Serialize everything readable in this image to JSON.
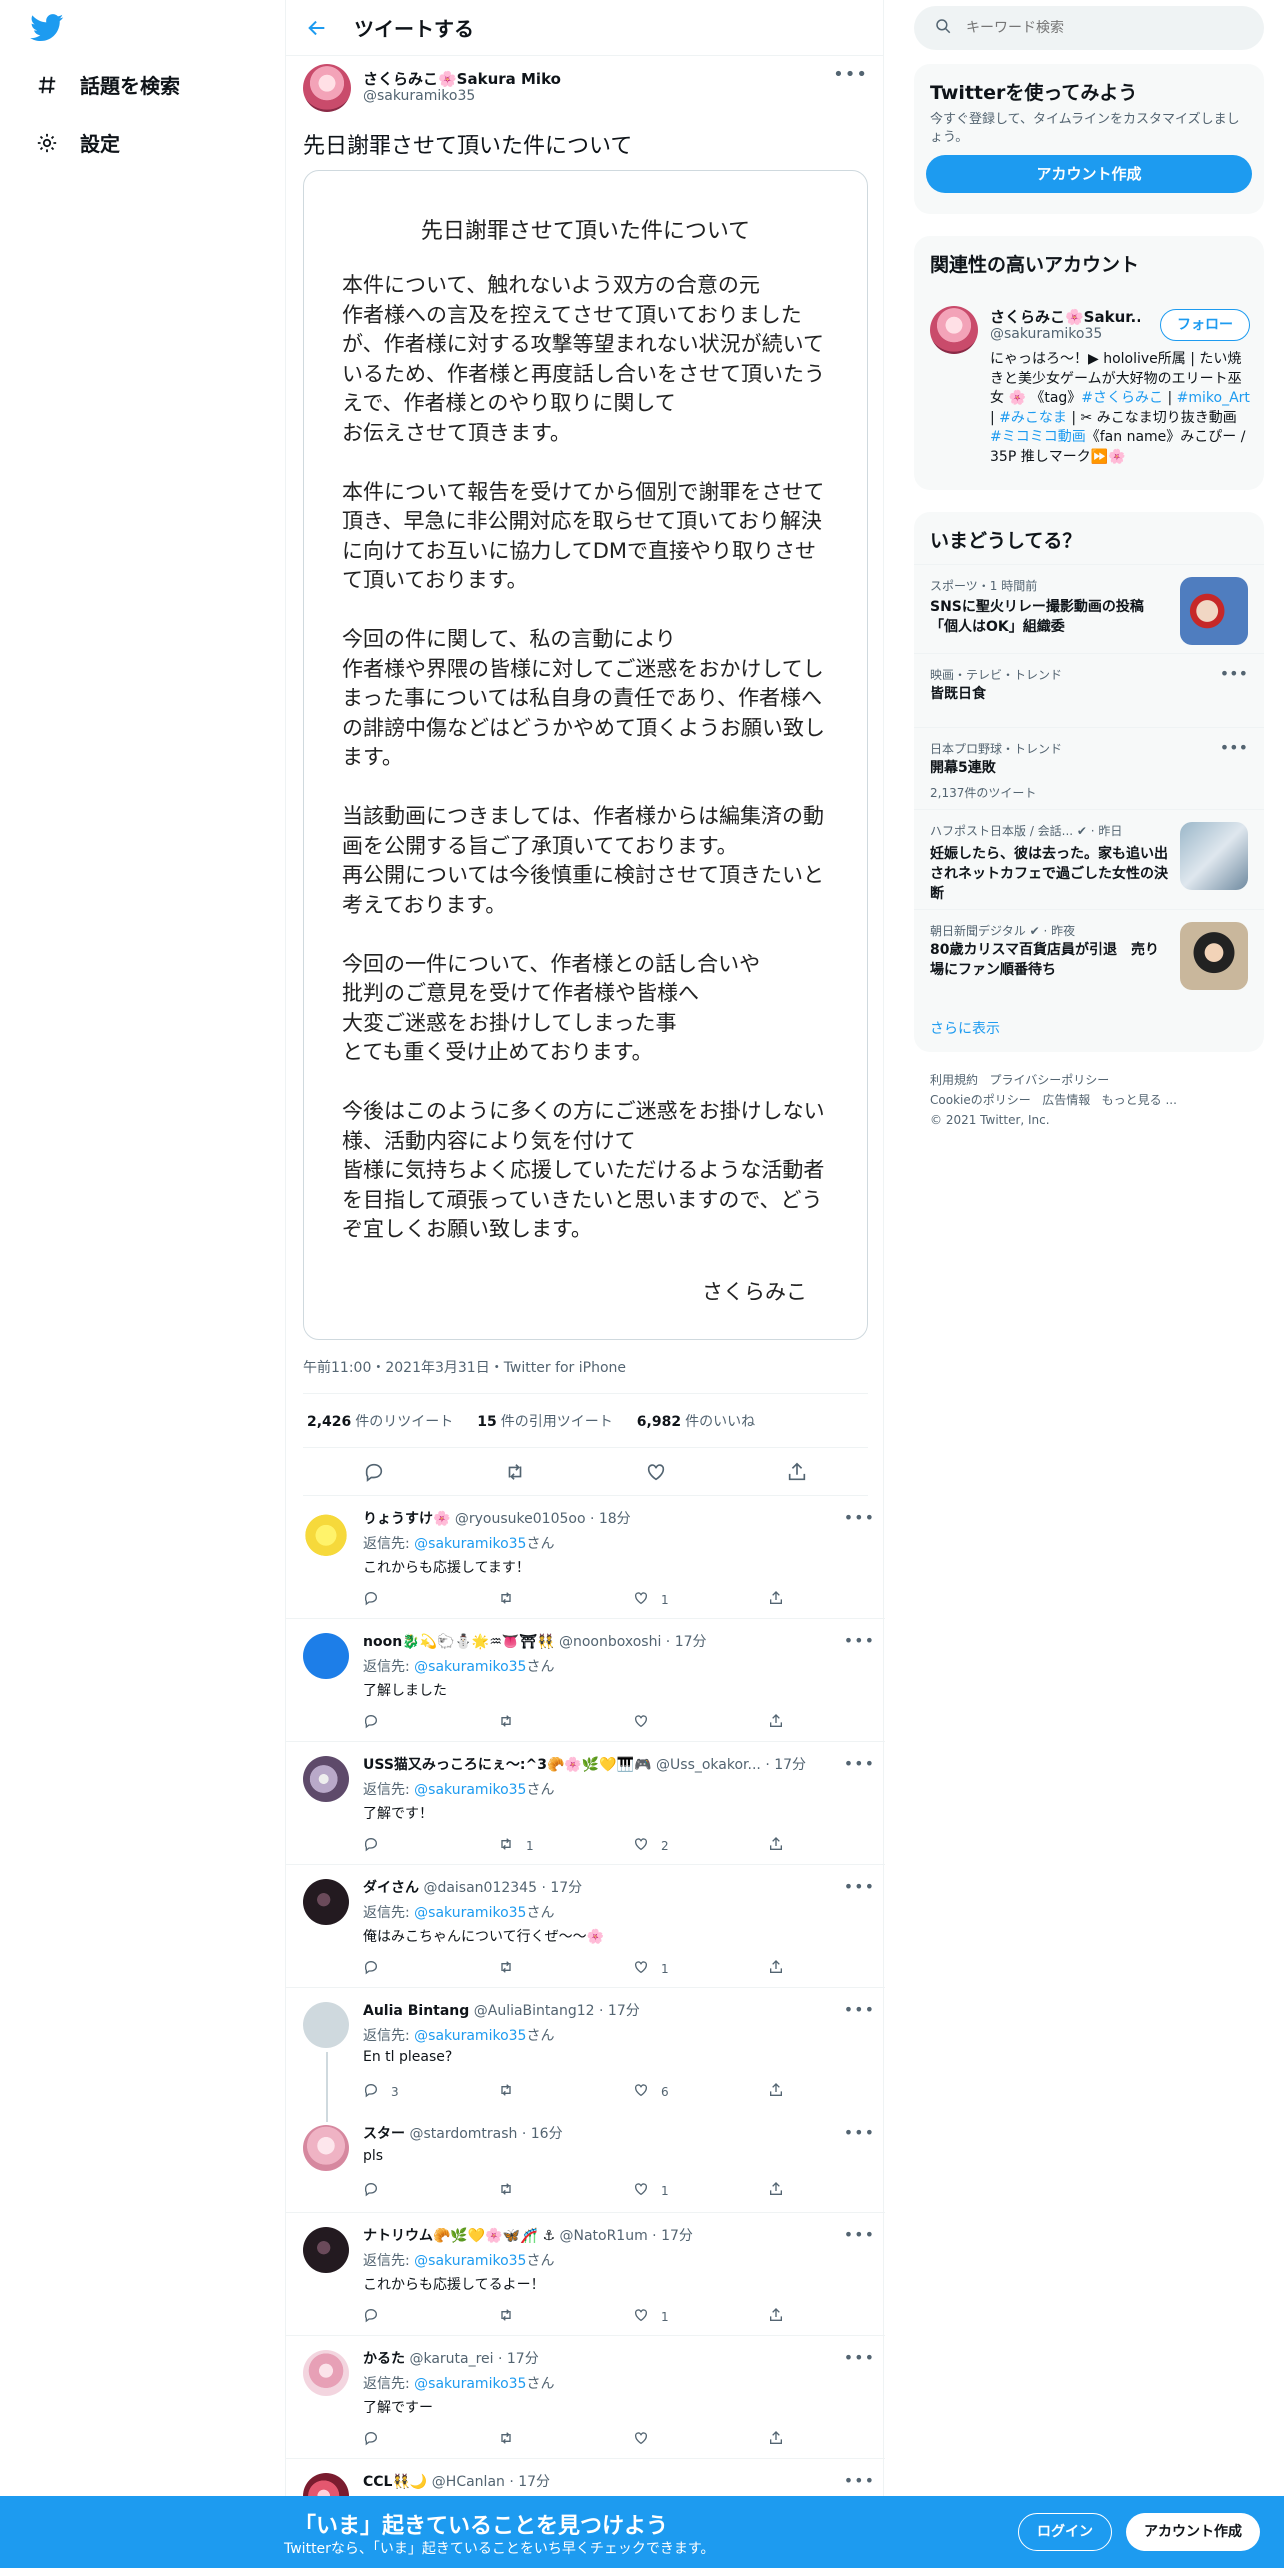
{
  "nav": {
    "explore": "話題を検索",
    "settings": "設定"
  },
  "header": {
    "title": "ツイートする"
  },
  "tweet": {
    "name": "さくらみこ🌸Sakura Miko",
    "handle": "@sakuramiko35",
    "text": "先日謝罪させて頂いた件について",
    "image": {
      "title": "先日謝罪させて頂いた件について",
      "paragraphs": [
        "本件について、触れないよう双方の合意の元\n作者様への言及を控えてさせて頂いておりましたが、作者様に対する攻撃等望まれない状況が続いているため、作者様と再度話し合いをさせて頂いたうえで、作者様とのやり取りに関して\nお伝えさせて頂きます。",
        "本件について報告を受けてから個別で謝罪をさせて頂き、早急に非公開対応を取らせて頂いており解決に向けてお互いに協力してDMで直接やり取りさせて頂いております。",
        "今回の件に関して、私の言動により\n作者様や界隈の皆様に対してご迷惑をおかけしてしまった事については私自身の責任であり、作者様への誹謗中傷などはどうかやめて頂くようお願い致します。",
        "当該動画につきましては、作者様からは編集済の動画を公開する旨ご了承頂いてております。\n再公開については今後慎重に検討させて頂きたいと考えております。",
        "今回の一件について、作者様との話し合いや\n批判のご意見を受けて作者様や皆様へ\n大変ご迷惑をお掛けしてしまった事\nとても重く受け止めております。",
        "今後はこのように多くの方にご迷惑をお掛けしない様、活動内容により気を付けて\n皆様に気持ちよく応援していただけるような活動者を目指して頑張っていきたいと思いますので、どうぞ宜しくお願い致します。"
      ],
      "signature": "さくらみこ"
    },
    "meta": "午前11:00・2021年3月31日・Twitter for iPhone",
    "retweets": "2,426",
    "retweets_label": "件のリツイート",
    "quotes": "15",
    "quotes_label": "件の引用ツイート",
    "likes": "6,982",
    "likes_label": "件のいいね"
  },
  "replies": [
    {
      "name": "りょうすけ🌸",
      "meta": "@ryousuke0105oo · 18分",
      "to": "@sakuramiko35",
      "text": "これからも応援してます！",
      "reply": "",
      "rt": "",
      "like": "1"
    },
    {
      "name": "noon🐉💫🐑⛄🌟♒👅⛩👯",
      "meta": "@noonboxoshi · 17分",
      "to": "@sakuramiko35",
      "text": "了解しました",
      "reply": "",
      "rt": "",
      "like": ""
    },
    {
      "name": "USS猫又みっころにぇ〜:^3🥐🌸🌿💛🎹🎮",
      "meta": "@Uss_okakor... · 17分",
      "to": "@sakuramiko35",
      "text": "了解です！",
      "reply": "",
      "rt": "1",
      "like": "2"
    },
    {
      "name": "ダイさん",
      "meta": "@daisan012345 · 17分",
      "to": "@sakuramiko35",
      "text": "俺はみこちゃんについて行くぜ〜〜🌸",
      "reply": "",
      "rt": "",
      "like": "1"
    },
    {
      "name": "Aulia Bintang",
      "meta": "@AuliaBintang12 · 17分",
      "to": "@sakuramiko35",
      "text": "En tl please?",
      "reply": "3",
      "rt": "",
      "like": "6"
    },
    {
      "name": "スター",
      "meta": "@stardomtrash · 16分",
      "to": "",
      "text": "pls",
      "reply": "",
      "rt": "",
      "like": "1"
    },
    {
      "name": "ナトリウム🥐🌿💛🌸🦋🎢 ⚓",
      "meta": "@NatoR1um · 17分",
      "to": "@sakuramiko35",
      "text": "これからも応援してるよー！",
      "reply": "",
      "rt": "",
      "like": "1"
    },
    {
      "name": "かるた",
      "meta": "@karuta_rei · 17分",
      "to": "@sakuramiko35",
      "text": "了解ですー",
      "reply": "",
      "rt": "",
      "like": ""
    },
    {
      "name": "CCL👯🌙",
      "meta": "@HCanlan · 17分",
      "to": "",
      "text": "",
      "reply": "",
      "rt": "",
      "like": ""
    }
  ],
  "reply_to_prefix": "返信先: ",
  "reply_to_suffix": "さん",
  "right": {
    "search_placeholder": "キーワード検索",
    "signup": {
      "title": "Twitterを使ってみよう",
      "desc": "今すぐ登録して、タイムラインをカスタマイズしましょう。",
      "button": "アカウント作成"
    },
    "related": {
      "title": "関連性の高いアカウント",
      "name": "さくらみこ🌸Sakur...",
      "handle": "@sakuramiko35",
      "follow": "フォロー",
      "bio1": "にゃっはろ〜！▶ hololive所属 | たい焼きと美少女ゲームが大好物のエリート巫女 🌸 《tag》",
      "bio_tag1": "#さくらみこ",
      "bio_sep": " | ",
      "bio_tag2": "#miko_Art",
      "bio_sep2": " | ",
      "bio_tag3": "#みこなま",
      "bio2": " | ✂ みこなま切り抜き動画 ",
      "bio_tag4": "#ミコミコ動画",
      "bio3": "《fan name》みこぴー / 35P 推しマーク⏩🌸"
    },
    "trends": {
      "title": "いまどうしてる？",
      "items": [
        {
          "cat": "スポーツ・1 時間前",
          "title": "SNSに聖火リレー撮影動画の投稿「個人はOK」組織委",
          "count": ""
        },
        {
          "cat": "映画・テレビ・トレンド",
          "title": "皆既日食",
          "count": ""
        },
        {
          "cat": "日本プロ野球・トレンド",
          "title": "開幕5連敗",
          "count": "2,137件のツイート"
        },
        {
          "cat": "ハフポスト日本版 / 会話... ✔ · 昨日",
          "title": "妊娠したら、彼は去った。家も追い出されネットカフェで過ごした女性の決断",
          "count": ""
        },
        {
          "cat": "朝日新聞デジタル ✔ · 昨夜",
          "title": "80歳カリスマ百貨店員が引退　売り場にファン順番待ち",
          "count": ""
        }
      ],
      "show_more": "さらに表示"
    },
    "footer": {
      "l1": "利用規約",
      "l2": "プライバシーポリシー",
      "l3": "Cookieのポリシー",
      "l4": "広告情報",
      "l5": "もっと見る ...",
      "copy": "© 2021 Twitter, Inc."
    }
  },
  "bottom": {
    "title": "「いま」起きていることを見つけよう",
    "sub": "Twitterなら、「いま」起きていることをいち早くチェックできます。",
    "login": "ログイン",
    "signup": "アカウント作成"
  },
  "colors": {
    "accent": "#1d9bf0",
    "text": "#0f1419",
    "muted": "#536471"
  }
}
